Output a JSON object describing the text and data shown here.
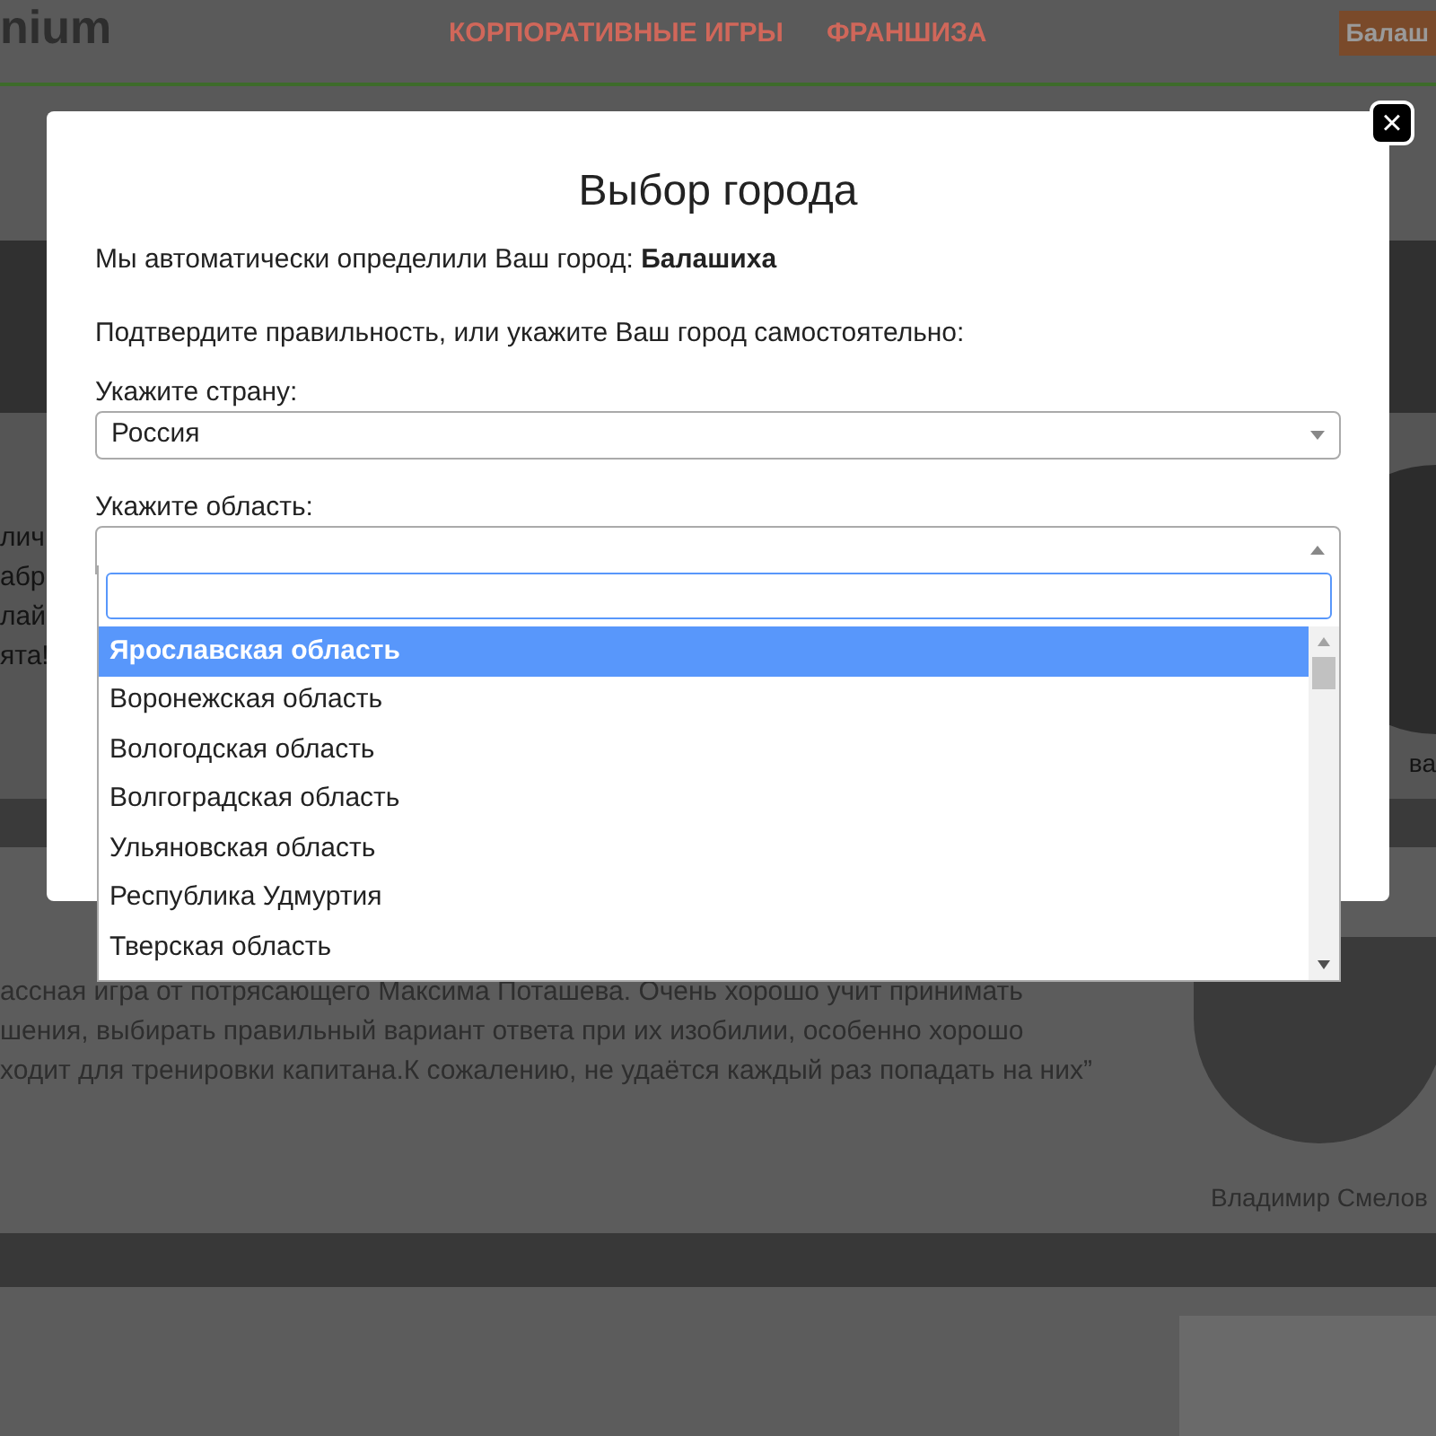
{
  "header": {
    "logo": "nium",
    "nav": [
      "КОРПОРАТИВНЫЕ ИГРЫ",
      "ФРАНШИЗА"
    ],
    "city_badge": "Балаш"
  },
  "background": {
    "left_fragments": [
      "лич",
      "абр",
      "лай",
      "ята!"
    ],
    "right_fragment": "ва",
    "review": {
      "lines": [
        "ассная игра от потрясающего Максима Поташева. Очень хорошо учит принимать",
        "шения, выбирать правильный вариант ответа при их изобилии, особенно хорошо",
        "ходит для тренировки капитана.К сожалению, не удаётся каждый раз попадать на них”"
      ],
      "author": "Владимир Смелов"
    }
  },
  "modal": {
    "close": "×",
    "title": "Выбор города",
    "detected": "Мы автоматически определили Ваш город: **Балашиха**",
    "prompt": "Подтвердите правильность, или укажите Ваш город самостоятельно:",
    "country_label": "Укажите страну:",
    "country_value": "Россия",
    "region_label": "Укажите область:",
    "region_dropdown": {
      "expanded": true,
      "options": [
        {
          "label": "Ярославская область",
          "selected": true
        },
        {
          "label": "Воронежская область",
          "selected": false
        },
        {
          "label": "Вологодская область",
          "selected": false
        },
        {
          "label": "Волгоградская область",
          "selected": false
        },
        {
          "label": "Ульяновская область",
          "selected": false
        },
        {
          "label": "Республика Удмуртия",
          "selected": false
        },
        {
          "label": "Тверская область",
          "selected": false
        }
      ]
    }
  }
}
